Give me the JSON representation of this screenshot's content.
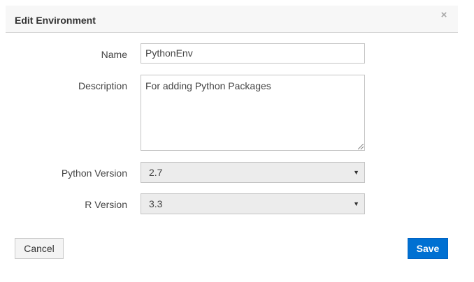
{
  "dialog": {
    "title": "Edit Environment",
    "close_glyph": "×",
    "close_icon": "close-icon"
  },
  "form": {
    "name_label": "Name",
    "name_value": "PythonEnv",
    "description_label": "Description",
    "description_value": "For adding Python Packages",
    "python_version_label": "Python Version",
    "python_version_value": "2.7",
    "r_version_label": "R Version",
    "r_version_value": "3.3",
    "caret_glyph": "▼",
    "caret_icon": "chevron-down-icon"
  },
  "buttons": {
    "cancel_label": "Cancel",
    "save_label": "Save"
  },
  "colors": {
    "primary": "#0070d2",
    "header_bg": "#f7f7f7",
    "select_bg": "#ececec"
  }
}
